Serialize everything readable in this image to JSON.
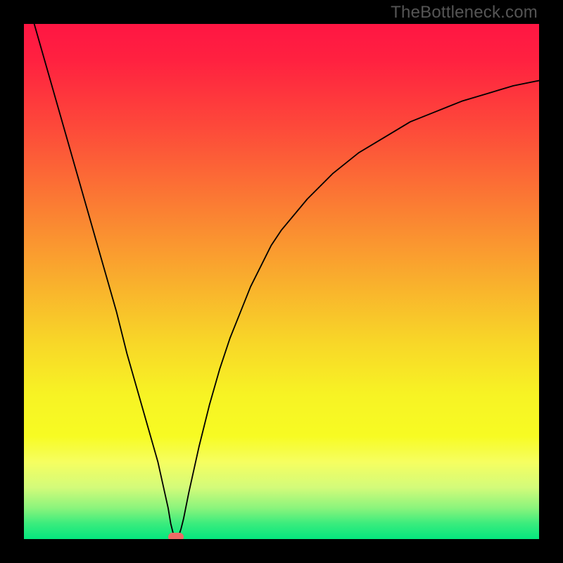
{
  "watermark": "TheBottleneck.com",
  "chart_data": {
    "type": "line",
    "title": "",
    "xlabel": "",
    "ylabel": "",
    "xlim": [
      0,
      100
    ],
    "ylim": [
      0,
      100
    ],
    "grid": false,
    "legend": false,
    "annotations": [],
    "series": [
      {
        "name": "bottleneck-curve",
        "x": [
          2,
          4,
          6,
          8,
          10,
          12,
          14,
          16,
          18,
          20,
          22,
          24,
          26,
          28,
          28.5,
          29,
          29.5,
          30,
          30.5,
          31,
          32,
          34,
          36,
          38,
          40,
          42,
          44,
          46,
          48,
          50,
          55,
          60,
          65,
          70,
          75,
          80,
          85,
          90,
          95,
          100
        ],
        "y": [
          100,
          93,
          86,
          79,
          72,
          65,
          58,
          51,
          44,
          36,
          29,
          22,
          15,
          6,
          3,
          1,
          0,
          0.5,
          2,
          4,
          9,
          18,
          26,
          33,
          39,
          44,
          49,
          53,
          57,
          60,
          66,
          71,
          75,
          78,
          81,
          83,
          85,
          86.5,
          88,
          89
        ]
      }
    ],
    "marker": {
      "x": 29.5,
      "y": 0,
      "color": "#ee6b66"
    },
    "background_gradient": {
      "stops": [
        {
          "offset": 0.0,
          "color": "#ff1643"
        },
        {
          "offset": 0.07,
          "color": "#ff2140"
        },
        {
          "offset": 0.2,
          "color": "#fd493a"
        },
        {
          "offset": 0.35,
          "color": "#fb7c33"
        },
        {
          "offset": 0.5,
          "color": "#f9af2d"
        },
        {
          "offset": 0.62,
          "color": "#f8d728"
        },
        {
          "offset": 0.72,
          "color": "#f7f324"
        },
        {
          "offset": 0.8,
          "color": "#f7fb23"
        },
        {
          "offset": 0.85,
          "color": "#f6fe60"
        },
        {
          "offset": 0.9,
          "color": "#d3fb7a"
        },
        {
          "offset": 0.94,
          "color": "#8af47c"
        },
        {
          "offset": 0.97,
          "color": "#3aec7d"
        },
        {
          "offset": 1.0,
          "color": "#04e77e"
        }
      ]
    }
  }
}
